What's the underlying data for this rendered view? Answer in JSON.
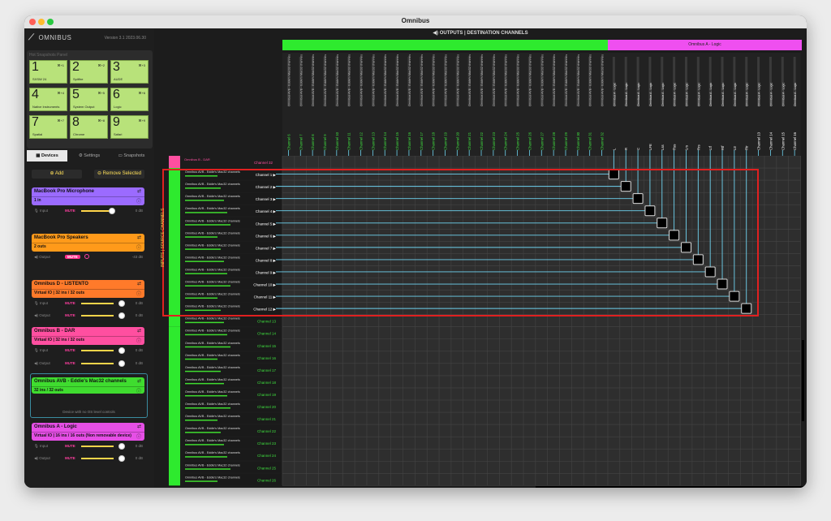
{
  "window": {
    "title": "Omnibus"
  },
  "sidebar": {
    "logo": "OMNIBUS",
    "version": "Version 3.1 2023.06.30",
    "hot_panel_title": "Hot Snapshots Panel",
    "slots": [
      {
        "num": "1",
        "key": "⌘+1",
        "name": "SXSW 24"
      },
      {
        "num": "2",
        "key": "⌘+2",
        "name": "Spitfire"
      },
      {
        "num": "3",
        "key": "⌘+3",
        "name": "AUDE"
      },
      {
        "num": "4",
        "key": "⌘+4",
        "name": "Native Instruments"
      },
      {
        "num": "5",
        "key": "⌘+5",
        "name": "System Output"
      },
      {
        "num": "6",
        "key": "⌘+6",
        "name": "Logic"
      },
      {
        "num": "7",
        "key": "⌘+7",
        "name": "Spatial"
      },
      {
        "num": "8",
        "key": "⌘+8",
        "name": "Chrome"
      },
      {
        "num": "9",
        "key": "⌘+9",
        "name": "Safari"
      }
    ],
    "tabs": [
      "Devices",
      "Settings",
      "Snapshots"
    ],
    "add_label": "Add",
    "remove_label": "Remove Selected",
    "devices": [
      {
        "name": "MacBook Pro Microphone",
        "sub": "1 in",
        "color": "#9b6bff"
      },
      {
        "name": "MacBook Pro Speakers",
        "sub": "2 outs",
        "color": "#ff9a1a"
      },
      {
        "name": "Omnibus D - LISTENTO",
        "sub": "Virtual IO | 32 ins / 32 outs",
        "color": "#ff7a2a"
      },
      {
        "name": "Omnibus B - DAR",
        "sub": "Virtual IO | 32 ins / 32 outs",
        "color": "#ff4fa0"
      },
      {
        "name": "Omnibus AVB - Eddie's Mac32 channels",
        "sub": "32 ins / 32 outs",
        "color": "#3fdc2f"
      },
      {
        "name": "Omnibus A - Logic",
        "sub": "Virtual IO | 16 ins / 16 outs (Non removable device)",
        "color": "#e64fe6"
      }
    ],
    "levels": {
      "input": "Input",
      "output": "Output",
      "mute": "MUTE",
      "db0": "0 dB",
      "dbm": "-43 dB"
    },
    "no_os_note": "Device with no OS level controls"
  },
  "main": {
    "outputs_title": "OUTPUTS | DESTINATION CHANNELS",
    "avb_bar_color": "#2eea2e",
    "logic_bar_label": "Omnibus A - Logic",
    "logic_bar_color": "#ef4ff0",
    "inputs_label": "INPUTS | SOURCE CHANNELS",
    "dar_label": "Omnibus B - DAR",
    "dar_channel": "Channel 32",
    "source_name": "Omnibus AVB - Eddie's Mac32 channels",
    "dest_channels": [
      "Channel 6",
      "Channel 7",
      "Channel 8",
      "Channel 9",
      "Channel 10",
      "Channel 11",
      "Channel 12",
      "Channel 13",
      "Channel 14",
      "Channel 15",
      "Channel 16",
      "Channel 17",
      "Channel 18",
      "Channel 19",
      "Channel 20",
      "Channel 21",
      "Channel 22",
      "Channel 23",
      "Channel 24",
      "Channel 25",
      "Channel 26",
      "Channel 27",
      "Channel 28",
      "Channel 29",
      "Channel 30",
      "Channel 31",
      "Channel 32"
    ],
    "logic_channels": [
      "L",
      "R",
      "C",
      "LFE",
      "Lss",
      "Rss",
      "Lrs",
      "Rrs",
      "Ltf",
      "Rtf",
      "Ltr",
      "Rtr",
      "Channel 13",
      "Channel 14",
      "Channel 15",
      "Channel 16"
    ],
    "src_channels": [
      "Channel 1",
      "Channel 2",
      "Channel 3",
      "Channel 4",
      "Channel 5",
      "Channel 6",
      "Channel 7",
      "Channel 8",
      "Channel 9",
      "Channel 10",
      "Channel 11",
      "Channel 12",
      "Channel 13",
      "Channel 14",
      "Channel 15",
      "Channel 16",
      "Channel 17",
      "Channel 18",
      "Channel 19",
      "Channel 20",
      "Channel 21",
      "Channel 22",
      "Channel 23",
      "Channel 24",
      "Channel 25",
      "Channel 26"
    ]
  }
}
